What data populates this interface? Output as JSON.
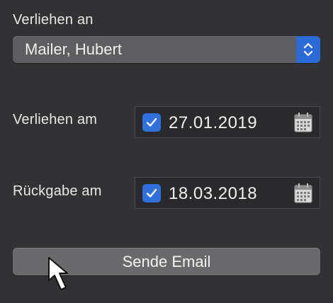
{
  "loaned_to": {
    "label": "Verliehen an",
    "selected_value": "Mailer, Hubert",
    "stepper_icon": "up-down-chevron-icon"
  },
  "loaned_on": {
    "label": "Verliehen am",
    "checked": true,
    "date": "27.01.2019",
    "calendar_icon": "calendar-icon"
  },
  "return_on": {
    "label": "Rückgabe am",
    "checked": true,
    "date": "18.03.2018",
    "calendar_icon": "calendar-icon"
  },
  "send_button": {
    "label": "Sende Email"
  },
  "colors": {
    "background": "#323234",
    "accent": "#2f70dc",
    "control": "#5e5e60",
    "field": "#2a2a2c"
  },
  "pointer_icon": "mouse-pointer-icon"
}
